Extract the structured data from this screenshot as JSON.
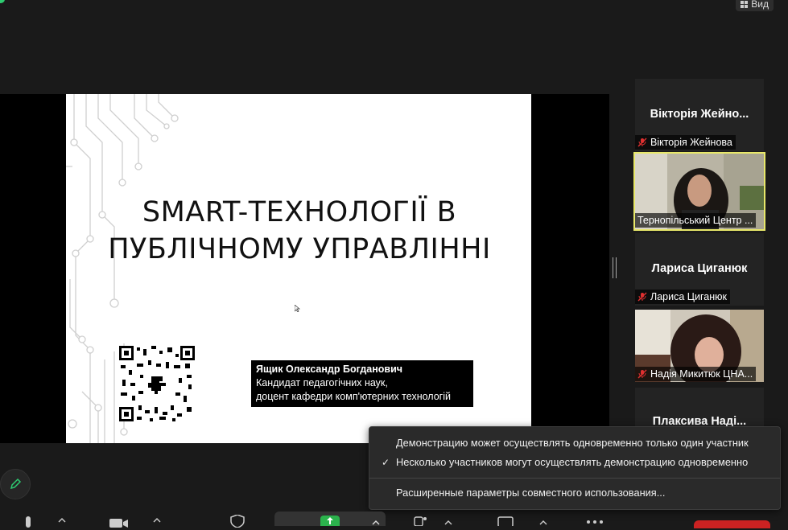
{
  "topbar": {
    "view_label": "Вид"
  },
  "slide": {
    "title": "SMART-ТЕХНОЛОГІЇ В\nПУБЛІЧНОМУ УПРАВЛІННІ",
    "author_name": "Ящик Олександр Богданович",
    "author_degree": "Кандидат педагогічних наук,",
    "author_position": "доцент кафедри комп'ютерних технологій"
  },
  "gallery": {
    "tiles": [
      {
        "display_name": "Вікторія  Жейно...",
        "tag": "Вікторія Жейнова"
      },
      {
        "tag": "Тернопільський Центр ..."
      },
      {
        "display_name": "Лариса Циганюк",
        "tag": "Лариса Циганюк"
      },
      {
        "tag": "Надія Микитюк ЦНА..."
      },
      {
        "display_name": "Плаксива  Наді..."
      }
    ]
  },
  "share_menu": {
    "items": [
      {
        "label": "Демонстрацию может осуществлять одновременно только один участник",
        "checked": false
      },
      {
        "label": "Несколько участников могут осуществлять демонстрацию одновременно",
        "checked": true
      },
      {
        "label": "Расширенные параметры совместного использования..."
      }
    ]
  },
  "colors": {
    "active_speaker": "#e8e86a",
    "share_green": "#2bb24c",
    "end_red": "#cc2222",
    "mute_red": "#e03030"
  },
  "icons": [
    "pencil-icon",
    "microphone-icon",
    "video-camera-icon",
    "security-shield-icon",
    "share-screen-icon",
    "participants-icon",
    "chat-icon",
    "more-icon",
    "view-grid-icon",
    "muted-mic-icon",
    "checkmark-icon"
  ]
}
